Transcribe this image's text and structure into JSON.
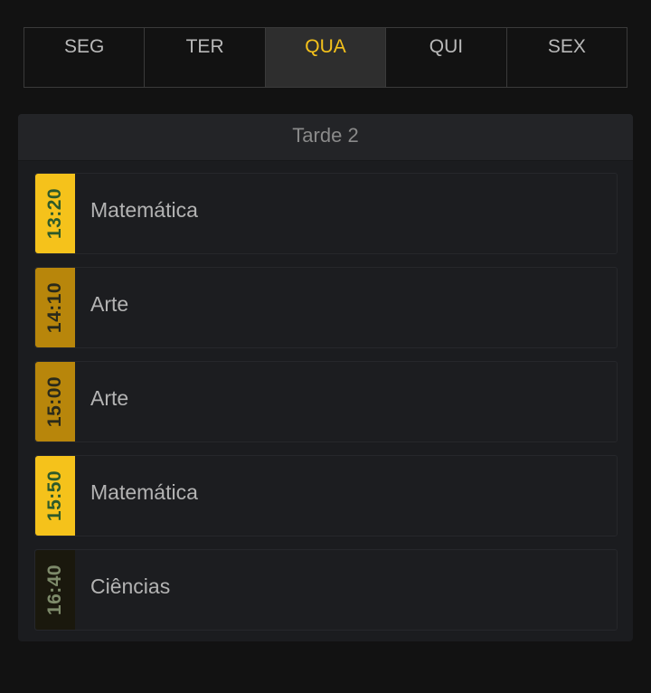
{
  "tabs": [
    {
      "label": "SEG",
      "active": false
    },
    {
      "label": "TER",
      "active": false
    },
    {
      "label": "QUA",
      "active": true
    },
    {
      "label": "QUI",
      "active": false
    },
    {
      "label": "SEX",
      "active": false
    }
  ],
  "panel": {
    "title": "Tarde 2",
    "items": [
      {
        "time": "13:20",
        "subject": "Matemática",
        "style": "bright"
      },
      {
        "time": "14:10",
        "subject": "Arte",
        "style": "dim"
      },
      {
        "time": "15:00",
        "subject": "Arte",
        "style": "dim"
      },
      {
        "time": "15:50",
        "subject": "Matemática",
        "style": "bright"
      },
      {
        "time": "16:40",
        "subject": "Ciências",
        "style": "dark"
      }
    ]
  },
  "colors": {
    "accent": "#f5c21b",
    "accent_dim": "#b8860b",
    "background": "#121212",
    "panel": "#1b1c1f"
  }
}
